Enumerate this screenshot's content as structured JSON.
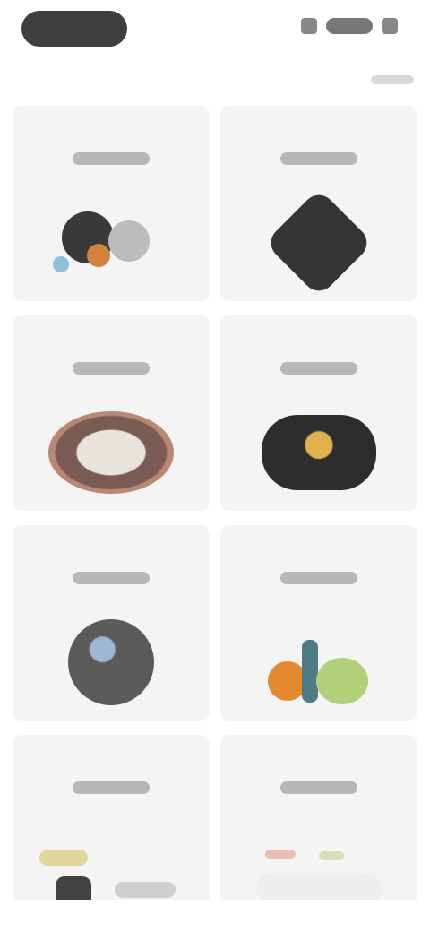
{
  "app": {
    "title": ""
  },
  "header": {
    "logo_label": "",
    "actions": [
      {
        "name": "icon-1",
        "label": ""
      },
      {
        "name": "icon-2",
        "label": ""
      },
      {
        "name": "icon-3",
        "label": ""
      }
    ]
  },
  "grid": {
    "cards": [
      {
        "title": "",
        "art": "cluster"
      },
      {
        "title": "",
        "art": "diamond"
      },
      {
        "title": "",
        "art": "ring"
      },
      {
        "title": "",
        "art": "dark"
      },
      {
        "title": "",
        "art": "blue"
      },
      {
        "title": "",
        "art": "tree"
      },
      {
        "title": "",
        "art": "chips"
      },
      {
        "title": "",
        "art": "dots"
      }
    ]
  },
  "colors": {
    "background": "#ffffff",
    "card": "#f4f4f4",
    "logo": "#3f3f3f"
  }
}
